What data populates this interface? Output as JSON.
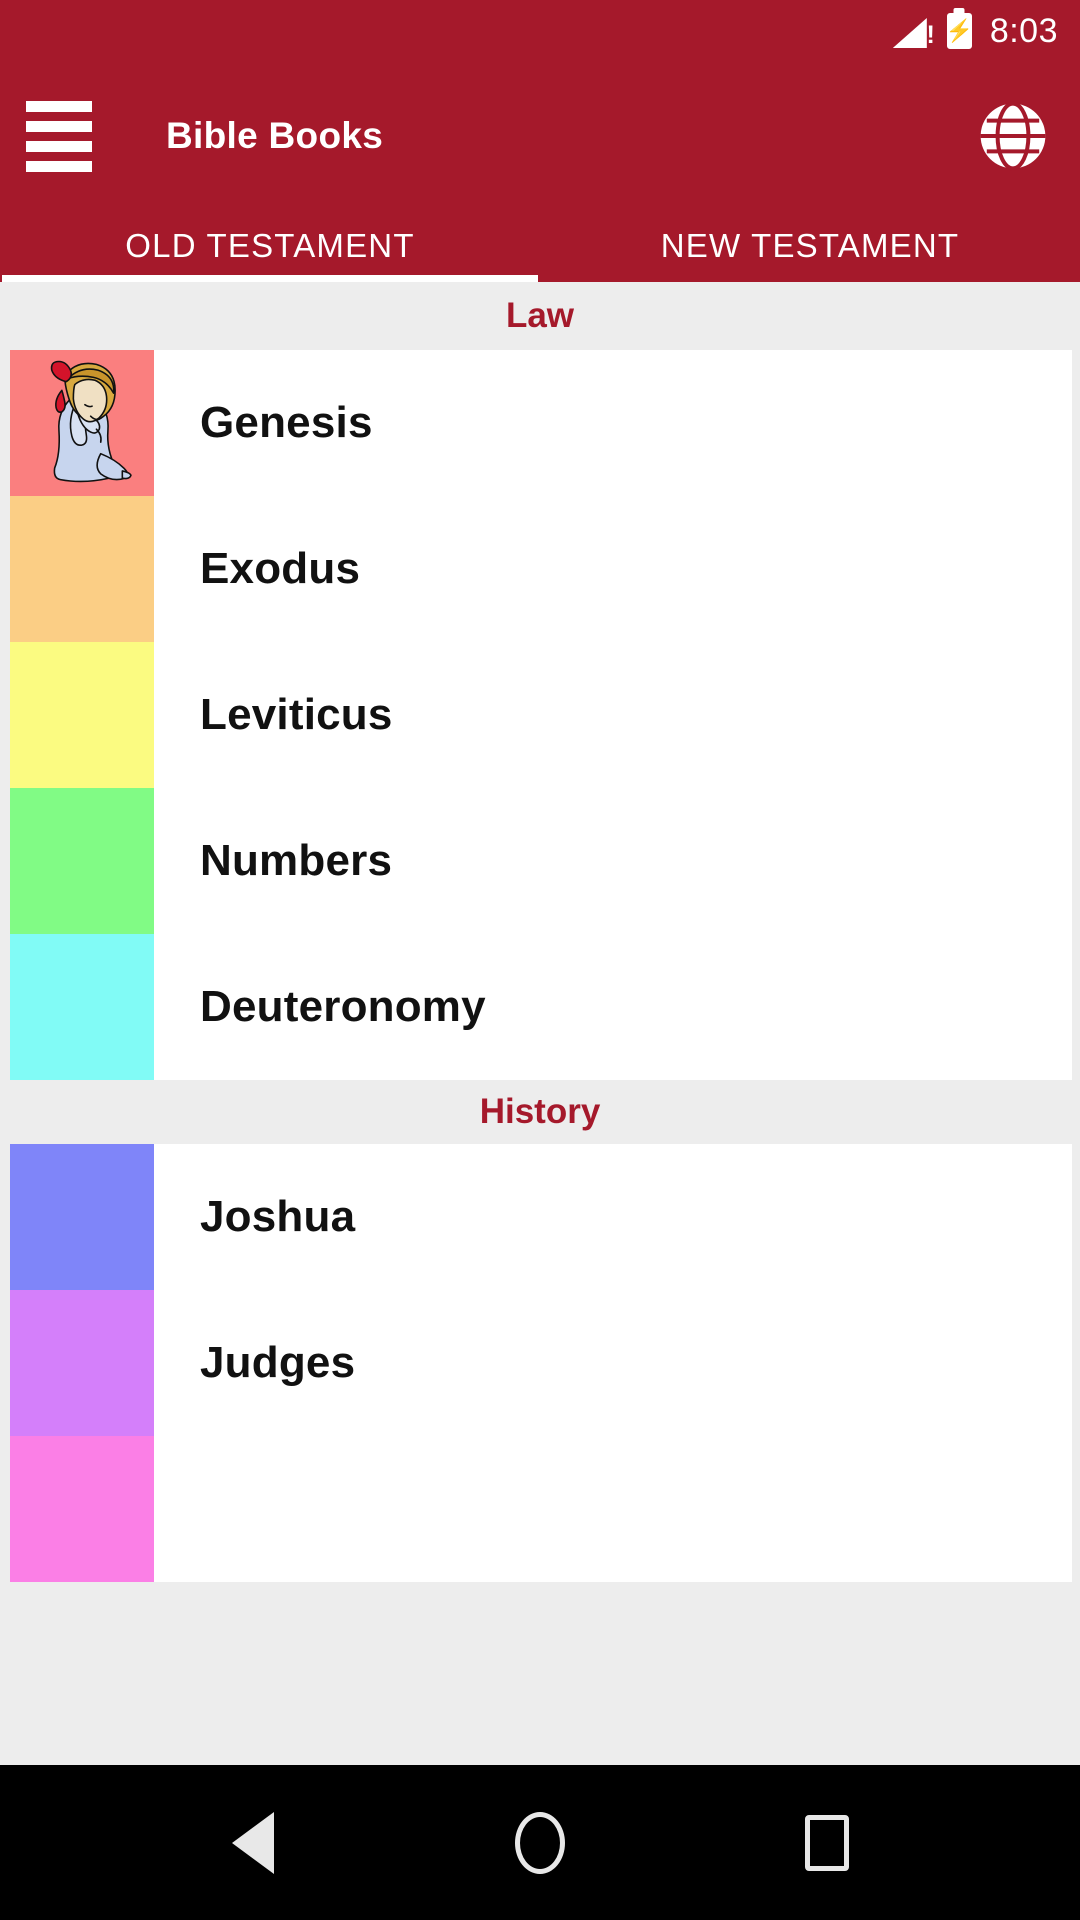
{
  "status_bar": {
    "time": "8:03",
    "signal_icon": "signal-alert-icon",
    "battery_icon": "battery-charging-icon",
    "bolt_glyph": "⚡"
  },
  "app_bar": {
    "title": "Bible Books",
    "menu_icon": "hamburger-menu-icon",
    "language_icon": "globe-icon"
  },
  "tabs": {
    "items": [
      {
        "label": "OLD TESTAMENT",
        "selected": true
      },
      {
        "label": "NEW TESTAMENT",
        "selected": false
      }
    ]
  },
  "colors": {
    "brand_red": "#A5192B",
    "section_header_text": "#A5192B",
    "list_background": "#EDEDED",
    "row_background": "#FFFFFF",
    "nav_bar": "#000000"
  },
  "sections": [
    {
      "title": "Law",
      "books": [
        {
          "name": "Genesis",
          "thumb_color": "#FA7F7F",
          "thumb_art": "praying-girl"
        },
        {
          "name": "Exodus",
          "thumb_color": "#FBCE85",
          "thumb_art": ""
        },
        {
          "name": "Leviticus",
          "thumb_color": "#FBFB81",
          "thumb_art": ""
        },
        {
          "name": "Numbers",
          "thumb_color": "#81FB85",
          "thumb_art": ""
        },
        {
          "name": "Deuteronomy",
          "thumb_color": "#81FBF6",
          "thumb_art": ""
        }
      ]
    },
    {
      "title": "History",
      "books": [
        {
          "name": "Joshua",
          "thumb_color": "#7F85F9",
          "thumb_art": ""
        },
        {
          "name": "Judges",
          "thumb_color": "#D47FFA",
          "thumb_art": ""
        },
        {
          "name": "",
          "thumb_color": "#FB7FE6",
          "thumb_art": ""
        }
      ]
    }
  ],
  "nav_bar": {
    "back_icon": "back-triangle-icon",
    "home_icon": "home-circle-icon",
    "recents_icon": "recents-square-icon"
  }
}
